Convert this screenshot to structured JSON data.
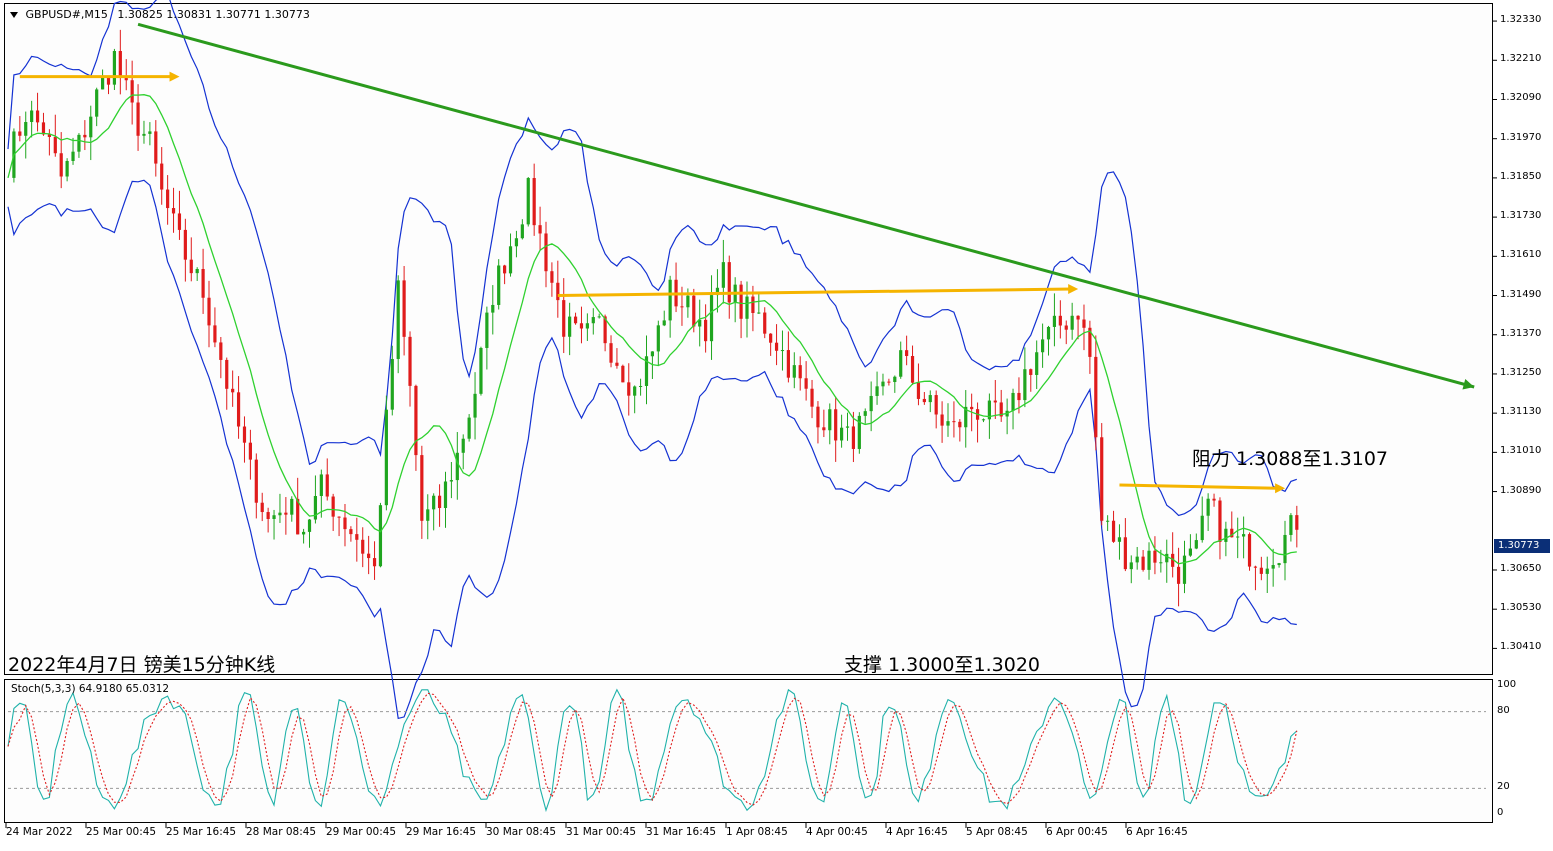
{
  "header": {
    "symbol": "GBPUSD#,M15",
    "ohlc": "1.30825 1.30831 1.30771 1.30773"
  },
  "annotations": {
    "title": "2022年4月7日 镑美15分钟K线",
    "resistance": "阻力 1.3088至1.3107",
    "support": "支撑 1.3000至1.3020"
  },
  "oscillator": {
    "label": "Stoch(5,3,3) 64.9180 65.0312",
    "k": 64.918,
    "d": 65.0312
  },
  "current_price": "1.30773",
  "colors": {
    "bull": "#1fa51f",
    "bear": "#e01b1b",
    "ma": "#2fd12f",
    "band": "#1432d2",
    "trendline": "#2b9a1d",
    "level": "#f5b400",
    "stoch_main": "#20b2aa",
    "stoch_signal": "#e02020"
  },
  "chart_data": [
    {
      "type": "candlestick",
      "symbol": "GBPUSD#",
      "timeframe": "M15",
      "title": "2022年4月7日 镑美15分钟K线",
      "ylim": [
        1.3035,
        1.3237
      ],
      "y_ticks": [
        "1.32330",
        "1.32210",
        "1.32090",
        "1.31970",
        "1.31850",
        "1.31730",
        "1.31610",
        "1.31490",
        "1.31370",
        "1.31250",
        "1.31130",
        "1.31010",
        "1.30890",
        "1.30773",
        "1.30650",
        "1.30530",
        "1.30410"
      ],
      "x_ticks": [
        "24 Mar 2022",
        "25 Mar 00:45",
        "25 Mar 16:45",
        "28 Mar 08:45",
        "29 Mar 00:45",
        "29 Mar 16:45",
        "30 Mar 08:45",
        "31 Mar 00:45",
        "31 Mar 16:45",
        "1 Apr 08:45",
        "4 Apr 00:45",
        "4 Apr 16:45",
        "5 Apr 08:45",
        "6 Apr 00:45",
        "6 Apr 16:45"
      ],
      "close_path": [
        [
          0,
          1.319
        ],
        [
          3,
          1.3205
        ],
        [
          6,
          1.32
        ],
        [
          9,
          1.3185
        ],
        [
          12,
          1.3195
        ],
        [
          15,
          1.321
        ],
        [
          18,
          1.3222
        ],
        [
          21,
          1.3205
        ],
        [
          24,
          1.3195
        ],
        [
          26,
          1.318
        ],
        [
          29,
          1.3165
        ],
        [
          33,
          1.315
        ],
        [
          36,
          1.313
        ],
        [
          38,
          1.3115
        ],
        [
          41,
          1.3095
        ],
        [
          44,
          1.308
        ],
        [
          47,
          1.3085
        ],
        [
          50,
          1.3078
        ],
        [
          53,
          1.309
        ],
        [
          56,
          1.3082
        ],
        [
          59,
          1.3075
        ],
        [
          62,
          1.3065
        ],
        [
          64,
          1.311
        ],
        [
          66,
          1.315
        ],
        [
          68,
          1.312
        ],
        [
          70,
          1.308
        ],
        [
          73,
          1.3085
        ],
        [
          76,
          1.31
        ],
        [
          79,
          1.312
        ],
        [
          82,
          1.315
        ],
        [
          85,
          1.3165
        ],
        [
          88,
          1.318
        ],
        [
          91,
          1.316
        ],
        [
          94,
          1.314
        ],
        [
          97,
          1.3135
        ],
        [
          100,
          1.314
        ],
        [
          103,
          1.313
        ],
        [
          106,
          1.312
        ],
        [
          109,
          1.3132
        ],
        [
          112,
          1.315
        ],
        [
          115,
          1.3145
        ],
        [
          118,
          1.314
        ],
        [
          121,
          1.3155
        ],
        [
          124,
          1.3145
        ],
        [
          127,
          1.3142
        ],
        [
          130,
          1.3135
        ],
        [
          133,
          1.3125
        ],
        [
          136,
          1.3115
        ],
        [
          139,
          1.311
        ],
        [
          142,
          1.3105
        ],
        [
          145,
          1.311
        ],
        [
          148,
          1.312
        ],
        [
          151,
          1.313
        ],
        [
          154,
          1.312
        ],
        [
          157,
          1.3112
        ],
        [
          160,
          1.3108
        ],
        [
          163,
          1.3115
        ],
        [
          166,
          1.3112
        ],
        [
          169,
          1.311
        ],
        [
          172,
          1.3125
        ],
        [
          175,
          1.3135
        ],
        [
          178,
          1.314
        ],
        [
          181,
          1.3145
        ],
        [
          183,
          1.313
        ],
        [
          185,
          1.308
        ],
        [
          187,
          1.3075
        ],
        [
          189,
          1.307
        ],
        [
          192,
          1.3068
        ],
        [
          195,
          1.307
        ],
        [
          198,
          1.3065
        ],
        [
          201,
          1.307
        ],
        [
          203,
          1.3085
        ],
        [
          206,
          1.3075
        ],
        [
          209,
          1.3072
        ],
        [
          212,
          1.3068
        ],
        [
          215,
          1.3072
        ],
        [
          218,
          1.308
        ]
      ],
      "trendline": {
        "start": [
          22,
          1.3232
        ],
        "end": [
          248,
          1.3121
        ],
        "color": "#2b9a1d"
      },
      "levels": [
        {
          "start": [
            2,
            1.3216
          ],
          "end": [
            28,
            1.3216
          ]
        },
        {
          "start": [
            93,
            1.3149
          ],
          "end": [
            180,
            1.3151
          ]
        },
        {
          "start": [
            188,
            1.3091
          ],
          "end": [
            215,
            1.309
          ]
        }
      ],
      "annotations": [
        "阻力 1.3088至1.3107",
        "支撑 1.3000至1.3020"
      ],
      "last_price": 1.30773
    },
    {
      "type": "line",
      "title": "Stoch(5,3,3) 64.9180 65.0312",
      "ylim": [
        0,
        100
      ],
      "y_ticks": [
        100,
        80,
        20,
        0
      ],
      "levels": [
        80,
        20
      ],
      "series": [
        {
          "name": "",
          "last": 64.918
        },
        {
          "name": "",
          "last": 65.0312
        }
      ]
    }
  ]
}
